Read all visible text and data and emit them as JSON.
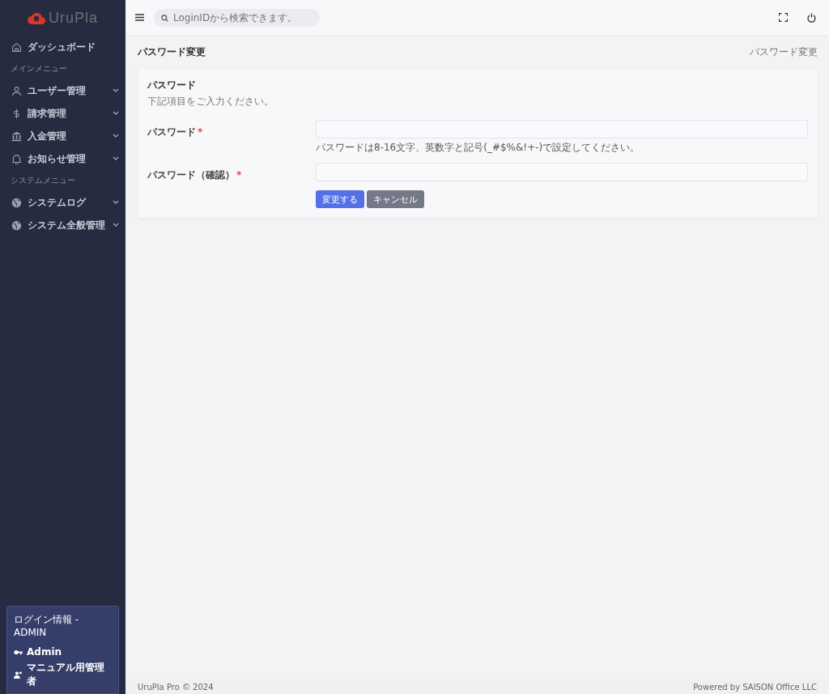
{
  "sidebar": {
    "logo": "UruPla",
    "items": [
      {
        "kind": "link",
        "label": "ダッシュボード",
        "submenu": false
      },
      {
        "kind": "heading",
        "label": "メインメニュー"
      },
      {
        "kind": "link",
        "label": "ユーザー管理",
        "submenu": true
      },
      {
        "kind": "link",
        "label": "請求管理",
        "submenu": true
      },
      {
        "kind": "link",
        "label": "入金管理",
        "submenu": true
      },
      {
        "kind": "link",
        "label": "お知らせ管理",
        "submenu": true
      },
      {
        "kind": "heading",
        "label": "システムメニュー"
      },
      {
        "kind": "link",
        "label": "システムログ",
        "submenu": true
      },
      {
        "kind": "link",
        "label": "システム全般管理",
        "submenu": true
      }
    ],
    "login_info": {
      "title": "ログイン情報 - ADMIN",
      "user": "Admin",
      "role": "マニュアル用管理者"
    }
  },
  "topbar": {
    "search": {
      "placeholder": "LoginIDから検索できます。"
    }
  },
  "page": {
    "title": "パスワード変更",
    "breadcrumb": "パスワード変更"
  },
  "card": {
    "title": "パスワード",
    "subtitle": "下記項目をご入力ください。",
    "fields": [
      {
        "label": "パスワード",
        "required_mark": "*",
        "help": "パスワードは8-16文字、英数字と記号(_#$%&!+-)で設定してください。"
      },
      {
        "label": "パスワード（確認）",
        "required_mark": "*"
      }
    ],
    "buttons": [
      {
        "kind": "primary",
        "label": "変更する"
      },
      {
        "kind": "secondary",
        "label": "キャンセル"
      }
    ]
  },
  "footer": {
    "left": "UruPla Pro © 2024",
    "right": "Powered by SAISON Office LLC"
  }
}
